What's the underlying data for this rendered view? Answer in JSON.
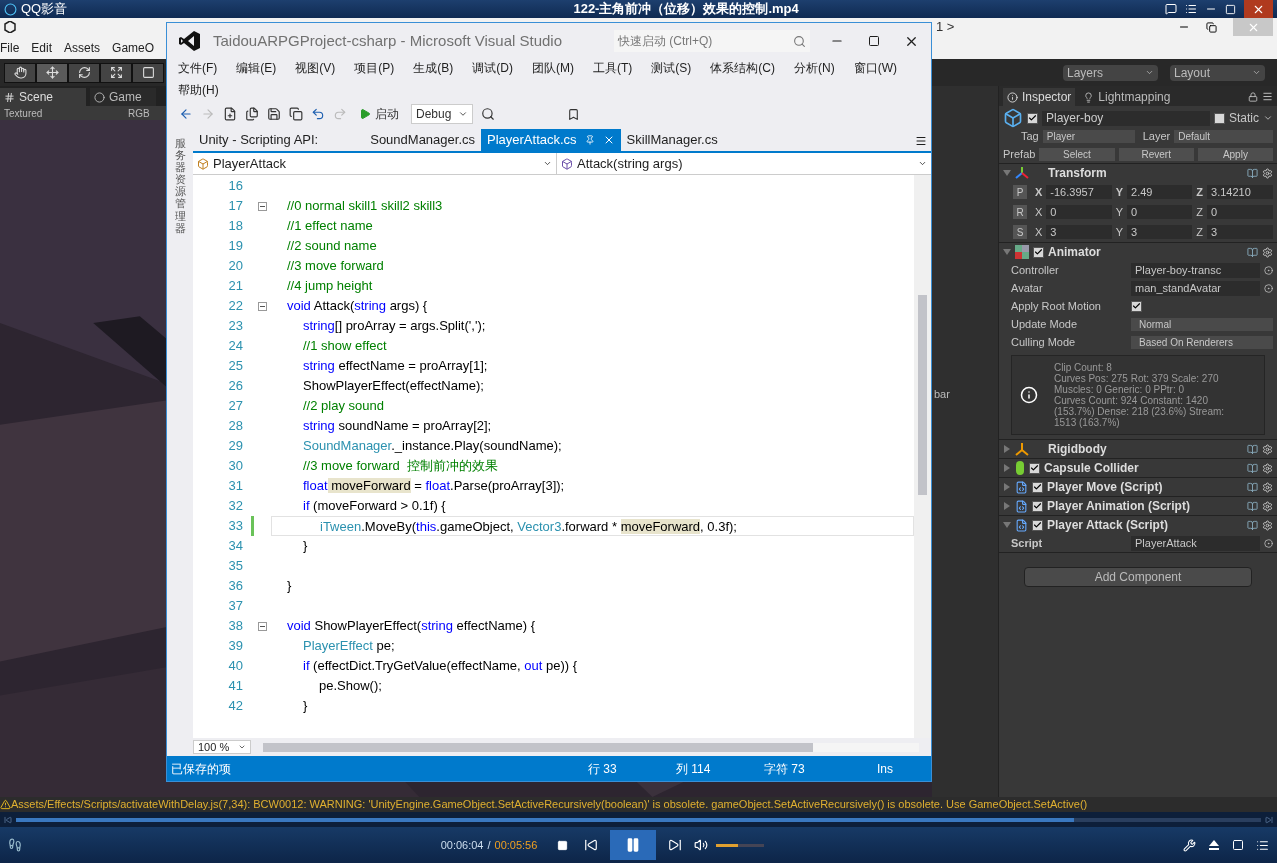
{
  "player": {
    "app_name": "QQ影音",
    "title": "122-主角前冲（位移）效果的控制.mp4",
    "warning": "Assets/Effects/Scripts/activateWithDelay.js(7,34): BCW0012: WARNING: 'UnityEngine.GameObject.SetActiveRecursively(boolean)' is obsolete. gameObject.SetActiveRecursively() is obsolete. Use GameObject.SetActive()",
    "progress": {
      "level": 0.85
    },
    "time_current": "00:06:04",
    "time_separator": "/",
    "time_total": "00:05:56",
    "playing": true,
    "volume": {
      "level": 0.45
    }
  },
  "unity": {
    "breadcrumb": "1 >",
    "menus": [
      "File",
      "Edit",
      "Assets",
      "GameO"
    ],
    "layers": "Layers",
    "layout": "Layout",
    "scene_tabs": [
      {
        "label": "Scene",
        "selected": true
      },
      {
        "label": "Game",
        "selected": false
      }
    ],
    "scene_options": [
      "Textured",
      "RGB"
    ],
    "middle_panel_label": "bar",
    "inspector": {
      "tabs": [
        {
          "label": "Inspector",
          "selected": true
        },
        {
          "label": "Lightmapping",
          "selected": false
        }
      ],
      "object": {
        "active": true,
        "name": "Player-boy",
        "static_label": "Static",
        "static": false,
        "tag_label": "Tag",
        "tag": "Player",
        "layer_label": "Layer",
        "layer": "Default",
        "prefab_label": "Prefab",
        "prefab_buttons": [
          "Select",
          "Revert",
          "Apply"
        ]
      },
      "components": [
        {
          "kind": "transform",
          "name": "Transform",
          "expanded": true,
          "rows": [
            {
              "button": "P",
              "cells": [
                {
                  "axis": "X",
                  "value": "-16.3957"
                },
                {
                  "axis": "Y",
                  "value": "2.49"
                },
                {
                  "axis": "Z",
                  "value": "3.14210"
                }
              ]
            },
            {
              "button": "R",
              "cells": [
                {
                  "axis": "X",
                  "value": "0"
                },
                {
                  "axis": "Y",
                  "value": "0"
                },
                {
                  "axis": "Z",
                  "value": "0"
                }
              ]
            },
            {
              "button": "S",
              "cells": [
                {
                  "axis": "X",
                  "value": "3"
                },
                {
                  "axis": "Y",
                  "value": "3"
                },
                {
                  "axis": "Z",
                  "value": "3"
                }
              ]
            }
          ]
        },
        {
          "kind": "animator",
          "name": "Animator",
          "enabled": true,
          "expanded": true,
          "fields": [
            {
              "kind": "object",
              "label": "Controller",
              "value": "Player-boy-transc"
            },
            {
              "kind": "object",
              "label": "Avatar",
              "value": "man_standAvatar"
            },
            {
              "kind": "checkbox",
              "label": "Apply Root Motion",
              "checked": true
            },
            {
              "kind": "select",
              "label": "Update Mode",
              "value": "Normal"
            },
            {
              "kind": "select",
              "label": "Culling Mode",
              "value": "Based On Renderers"
            }
          ],
          "info": [
            "Clip Count: 8",
            "Curves Pos: 275 Rot: 379 Scale: 270",
            "Muscles: 0 Generic: 0 PPtr: 0",
            "Curves Count: 924 Constant: 1420",
            "(153.7%) Dense: 218 (23.6%) Stream:",
            "1513 (163.7%)"
          ]
        },
        {
          "kind": "rigidbody",
          "name": "Rigidbody",
          "expanded": false
        },
        {
          "kind": "collider",
          "name": "Capsule Collider",
          "enabled": true,
          "expanded": false
        },
        {
          "kind": "script",
          "name": "Player Move (Script)",
          "enabled": true,
          "expanded": false
        },
        {
          "kind": "script",
          "name": "Player Animation (Script)",
          "enabled": true,
          "expanded": false
        },
        {
          "kind": "script",
          "name": "Player Attack (Script)",
          "enabled": true,
          "expanded": true,
          "fields": [
            {
              "kind": "object",
              "label": "Script",
              "value": "PlayerAttack"
            }
          ]
        }
      ],
      "add_component": "Add Component"
    }
  },
  "vs": {
    "title": "TaidouARPGProject-csharp - Microsoft Visual Studio",
    "quick_launch": {
      "placeholder": "快速启动 (Ctrl+Q)"
    },
    "menus": [
      "文件(F)",
      "编辑(E)",
      "视图(V)",
      "项目(P)",
      "生成(B)",
      "调试(D)",
      "团队(M)",
      "工具(T)",
      "测试(S)",
      "体系结构(C)",
      "分析(N)",
      "窗口(W)",
      "帮助(H)"
    ],
    "start": "启动",
    "config": "Debug",
    "side_tab": "服务器资源管理器",
    "tabs": [
      {
        "label": "Unity - Scripting API:",
        "selected": false
      },
      {
        "label": "SoundManager.cs",
        "selected": false
      },
      {
        "label": "PlayerAttack.cs",
        "selected": true
      },
      {
        "label": "SkillManager.cs",
        "selected": false
      }
    ],
    "nav_class": "PlayerAttack",
    "nav_member": "Attack(string args)",
    "zoom": "100 %",
    "lines": [
      {
        "number": "16",
        "fold": false,
        "current": false
      },
      {
        "number": "17",
        "fold": true,
        "current": false,
        "tokens": [
          {
            "kind": "comment",
            "text": "//0 normal skill1 skill2 skill3"
          }
        ]
      },
      {
        "number": "18",
        "fold": false,
        "current": false,
        "tokens": [
          {
            "kind": "comment",
            "text": "//1 effect name"
          }
        ]
      },
      {
        "number": "19",
        "fold": false,
        "current": false,
        "tokens": [
          {
            "kind": "comment",
            "text": "//2 sound name"
          }
        ]
      },
      {
        "number": "20",
        "fold": false,
        "current": false,
        "tokens": [
          {
            "kind": "comment",
            "text": "//3 move forward"
          }
        ]
      },
      {
        "number": "21",
        "fold": false,
        "current": false,
        "tokens": [
          {
            "kind": "comment",
            "text": "//4 jump height"
          }
        ]
      },
      {
        "number": "22",
        "fold": true,
        "current": false,
        "tokens": [
          {
            "kind": "keyword",
            "text": "void"
          },
          {
            "kind": "plain",
            "text": " Attack("
          },
          {
            "kind": "keyword",
            "text": "string"
          },
          {
            "kind": "plain",
            "text": " args) {"
          }
        ],
        "children": [
          {
            "number": "23",
            "fold": false,
            "current": false,
            "tokens": [
              {
                "kind": "keyword",
                "text": "string"
              },
              {
                "kind": "plain",
                "text": "[] proArray = args.Split(',');"
              }
            ]
          },
          {
            "number": "24",
            "fold": false,
            "current": false,
            "tokens": [
              {
                "kind": "comment",
                "text": "//1 show effect"
              }
            ]
          },
          {
            "number": "25",
            "fold": false,
            "current": false,
            "tokens": [
              {
                "kind": "keyword",
                "text": "string"
              },
              {
                "kind": "plain",
                "text": " effectName = proArray[1];"
              }
            ]
          },
          {
            "number": "26",
            "fold": false,
            "current": false,
            "tokens": [
              {
                "kind": "plain",
                "text": "ShowPlayerEffect(effectName);"
              }
            ]
          },
          {
            "number": "27",
            "fold": false,
            "current": false,
            "tokens": [
              {
                "kind": "comment",
                "text": "//2 play sound"
              }
            ]
          },
          {
            "number": "28",
            "fold": false,
            "current": false,
            "tokens": [
              {
                "kind": "keyword",
                "text": "string"
              },
              {
                "kind": "plain",
                "text": " soundName = proArray[2];"
              }
            ]
          },
          {
            "number": "29",
            "fold": false,
            "current": false,
            "tokens": [
              {
                "kind": "type",
                "text": "SoundManager"
              },
              {
                "kind": "plain",
                "text": "._instance.Play(soundName);"
              }
            ]
          },
          {
            "number": "30",
            "fold": false,
            "current": false,
            "tokens": [
              {
                "kind": "comment",
                "text": "//3 move forward  控制前冲的效果"
              }
            ]
          },
          {
            "number": "31",
            "fold": false,
            "current": false,
            "tokens": [
              {
                "kind": "keyword",
                "text": "float"
              },
              {
                "kind": "highlight",
                "text": " moveForward"
              },
              {
                "kind": "plain",
                "text": " = "
              },
              {
                "kind": "keyword",
                "text": "float"
              },
              {
                "kind": "plain",
                "text": ".Parse(proArray[3]);"
              }
            ]
          },
          {
            "number": "32",
            "fold": false,
            "current": false,
            "tokens": [
              {
                "kind": "keyword",
                "text": "if"
              },
              {
                "kind": "plain",
                "text": " (moveForward > 0.1f) {"
              }
            ],
            "children": [
              {
                "number": "33",
                "fold": false,
                "current": true,
                "tokens": [
                  {
                    "kind": "type",
                    "text": "iTween"
                  },
                  {
                    "kind": "plain",
                    "text": ".MoveBy("
                  },
                  {
                    "kind": "keyword",
                    "text": "this"
                  },
                  {
                    "kind": "plain",
                    "text": ".gameObject, "
                  },
                  {
                    "kind": "type",
                    "text": "Vector3"
                  },
                  {
                    "kind": "plain",
                    "text": ".forward * "
                  },
                  {
                    "kind": "highlight",
                    "text": "moveForward"
                  },
                  {
                    "kind": "plain",
                    "text": ", 0.3f);"
                  }
                ]
              }
            ]
          },
          {
            "number": "34",
            "fold": false,
            "current": false,
            "tokens": [
              {
                "kind": "plain",
                "text": "}"
              }
            ]
          },
          {
            "number": "35",
            "fold": false,
            "current": false
          }
        ]
      },
      {
        "number": "36",
        "fold": false,
        "current": false,
        "tokens": [
          {
            "kind": "plain",
            "text": "}"
          }
        ]
      },
      {
        "number": "37",
        "fold": false,
        "current": false
      },
      {
        "number": "38",
        "fold": true,
        "current": false,
        "tokens": [
          {
            "kind": "keyword",
            "text": "void"
          },
          {
            "kind": "plain",
            "text": " ShowPlayerEffect("
          },
          {
            "kind": "keyword",
            "text": "string"
          },
          {
            "kind": "plain",
            "text": " effectName) {"
          }
        ],
        "children": [
          {
            "number": "39",
            "fold": false,
            "current": false,
            "tokens": [
              {
                "kind": "type",
                "text": "PlayerEffect"
              },
              {
                "kind": "plain",
                "text": " pe;"
              }
            ]
          },
          {
            "number": "40",
            "fold": false,
            "current": false,
            "tokens": [
              {
                "kind": "keyword",
                "text": "if"
              },
              {
                "kind": "plain",
                "text": " (effectDict.TryGetValue(effectName, "
              },
              {
                "kind": "keyword",
                "text": "out"
              },
              {
                "kind": "plain",
                "text": " pe)) {"
              }
            ],
            "children": [
              {
                "number": "41",
                "fold": false,
                "current": false,
                "tokens": [
                  {
                    "kind": "plain",
                    "text": "pe.Show();"
                  }
                ]
              }
            ]
          },
          {
            "number": "42",
            "fold": false,
            "current": false,
            "tokens": [
              {
                "kind": "plain",
                "text": "}"
              }
            ]
          }
        ]
      }
    ],
    "status": [
      {
        "kind": "message",
        "text": "已保存的项"
      },
      {
        "kind": "line",
        "text": "行 33"
      },
      {
        "kind": "column",
        "text": "列 114"
      },
      {
        "kind": "char",
        "text": "字符 73"
      },
      {
        "kind": "mode",
        "text": "Ins"
      }
    ]
  }
}
